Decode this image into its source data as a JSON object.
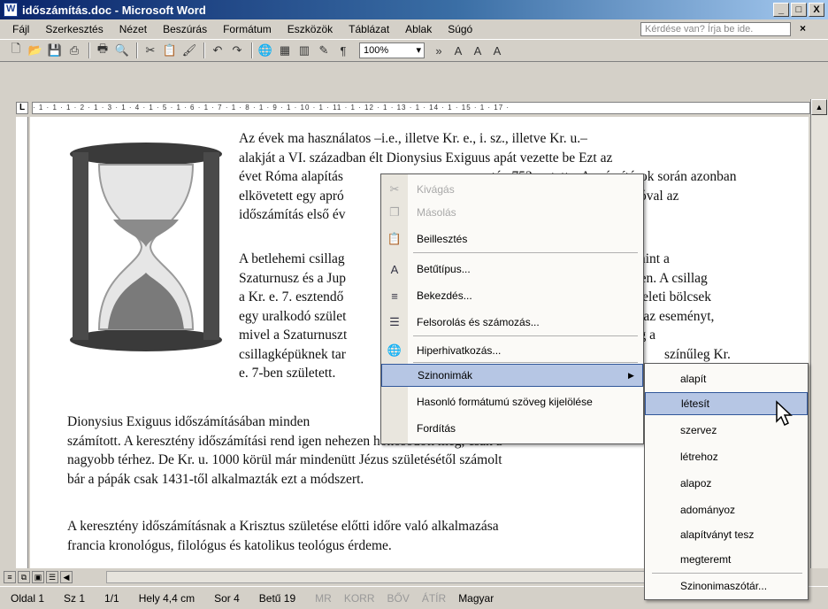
{
  "window": {
    "title": "időszámítás.doc - Microsoft Word",
    "min": "_",
    "max": "□",
    "close": "X"
  },
  "menubar": {
    "items": [
      "Fájl",
      "Szerkesztés",
      "Nézet",
      "Beszúrás",
      "Formátum",
      "Eszközök",
      "Táblázat",
      "Ablak",
      "Súgó"
    ],
    "help_placeholder": "Kérdése van? Írja be ide.",
    "doc_close": "×"
  },
  "toolbar": {
    "zoom": "100%",
    "more": "»"
  },
  "ruler": {
    "numbers": "· 1 · 1 · 1 · 2 · 1 · 3 · 1 · 4 · 1 · 5 · 1 · 6 · 1 · 7 · 1 · 8 · 1 · 9 · 1 · 10 · 1 · 11 · 1 · 12 · 1 · 13 · 1 · 14 · 1 · 15 · 1 · 17 ·"
  },
  "document": {
    "p1": [
      "Az évek ma használatos –i.e., illetve Kr. e., i. sz., illetve Kr. u.–",
      "alakját a VI. században élt Dionysius Exiguus apát vezette be Ezt az",
      "évet Róma alapítás",
      "elkövetett egy apró",
      "időszámítás első év"
    ],
    "p1_right": [
      "után 753-ra tette. A számítások során azonban",
      "s jóval az",
      ""
    ],
    "p2": [
      "A betlehemi csillag",
      "Szaturnusz és a Jup",
      "a Kr. e. 7. esztendő",
      "egy uralkodó szület",
      "mivel a Szaturnuszt",
      "csillagképüknek tar",
      "e. 7-ben született."
    ],
    "p2_right": [
      "mint a",
      "ében. A csillag",
      "keleti bölcsek",
      "az eseményt,",
      "ig a",
      "színűleg Kr."
    ],
    "p3": [
      "Dionysius Exiguus időszámításában minden",
      "számított. A keresztény időszámítási rend igen nehezen honosodott meg, csak a",
      "nagyobb térhez. De Kr. u. 1000 körül már mindenütt Jézus születésétől számolt",
      "bár a pápák csak 1431-től alkalmazták ezt a módszert."
    ],
    "p4": [
      "A keresztény időszámításnak a Krisztus születése előtti időre való alkalmazása",
      "francia kronológus, filológus és katolikus teológus érdeme."
    ]
  },
  "context_menu": {
    "items": [
      {
        "label": "Kivágás",
        "icon": "cut-icon",
        "glyph": "✂",
        "disabled": true
      },
      {
        "label": "Másolás",
        "icon": "copy-icon",
        "glyph": "❐",
        "disabled": true
      },
      {
        "label": "Beillesztés",
        "icon": "paste-icon",
        "glyph": "📋",
        "disabled": false
      },
      {
        "label": "Betűtípus...",
        "icon": "font-icon",
        "glyph": "A",
        "disabled": false
      },
      {
        "label": "Bekezdés...",
        "icon": "paragraph-icon",
        "glyph": "≡",
        "disabled": false
      },
      {
        "label": "Felsorolás és számozás...",
        "icon": "bullets-icon",
        "glyph": "☰",
        "disabled": false
      },
      {
        "label": "Hiperhivatkozás...",
        "icon": "hyperlink-icon",
        "glyph": "🌐",
        "disabled": false
      },
      {
        "label": "Szinonimák",
        "icon": "",
        "glyph": "",
        "disabled": false
      },
      {
        "label": "Hasonló formátumú szöveg kijelölése",
        "icon": "",
        "glyph": "",
        "disabled": false
      },
      {
        "label": "Fordítás",
        "icon": "",
        "glyph": "",
        "disabled": false
      }
    ],
    "submenu_arrow": "▶"
  },
  "synonyms_submenu": {
    "items": [
      "alapít",
      "létesít",
      "szervez",
      "létrehoz",
      "alapoz",
      "adományoz",
      "alapítványt tesz",
      "megteremt"
    ],
    "thesaurus": "Szinonimaszótár..."
  },
  "statusbar": {
    "page": "Oldal 1",
    "section": "Sz 1",
    "pages": "1/1",
    "pos": "Hely 4,4 cm",
    "line": "Sor 4",
    "col": "Betű 19",
    "modes": [
      "MR",
      "KORR",
      "BŐV",
      "ÁTÍR"
    ],
    "lang": "Magyar"
  }
}
